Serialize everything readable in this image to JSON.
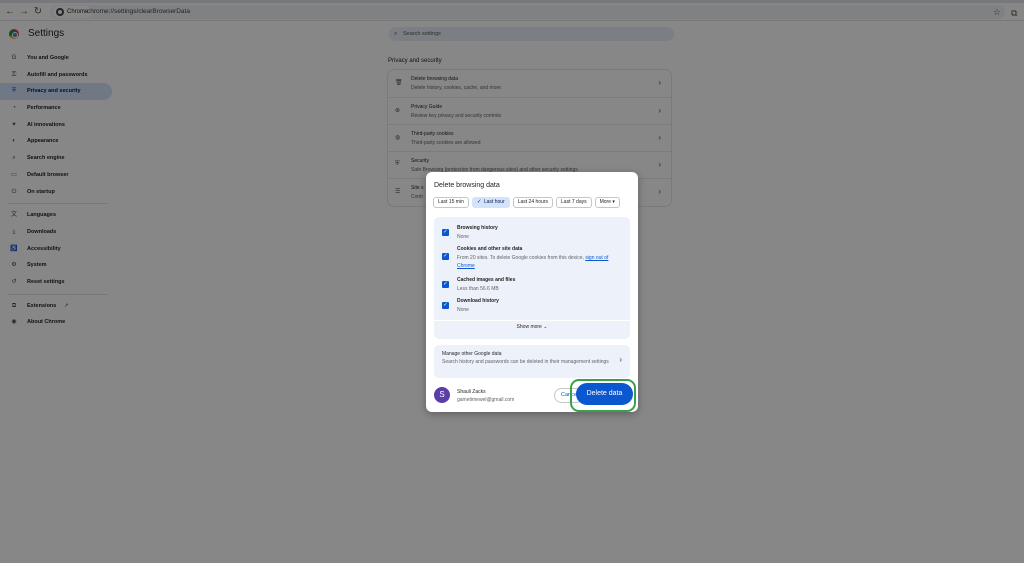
{
  "browser": {
    "chip_label": "Chrome",
    "url": "chrome://settings/clearBrowserData",
    "back_icon": "←",
    "forward_icon": "→",
    "reload_icon": "↻",
    "star_icon": "☆",
    "extensions_icon": "⧉"
  },
  "header": {
    "title": "Settings",
    "search_placeholder": "Search settings"
  },
  "sidebar": {
    "items": [
      {
        "label": "You and Google",
        "icon": "G"
      },
      {
        "label": "Autofill and passwords",
        "icon": "⚿"
      },
      {
        "label": "Privacy and security",
        "icon": "⛨"
      },
      {
        "label": "Performance",
        "icon": "◔"
      },
      {
        "label": "AI innovations",
        "icon": "✦"
      },
      {
        "label": "Appearance",
        "icon": "◐"
      },
      {
        "label": "Search engine",
        "icon": "⌕"
      },
      {
        "label": "Default browser",
        "icon": "▭"
      },
      {
        "label": "On startup",
        "icon": "⏻"
      },
      {
        "label": "Languages",
        "icon": "文"
      },
      {
        "label": "Downloads",
        "icon": "⤓"
      },
      {
        "label": "Accessibility",
        "icon": "♿"
      },
      {
        "label": "System",
        "icon": "⚙"
      },
      {
        "label": "Reset settings",
        "icon": "↺"
      },
      {
        "label": "Extensions",
        "icon": "⧉",
        "ext_icon": "↗"
      },
      {
        "label": "About Chrome",
        "icon": "◉"
      }
    ]
  },
  "main": {
    "section_title": "Privacy and security",
    "rows": [
      {
        "title": "Delete browsing data",
        "subtitle": "Delete history, cookies, cache, and more",
        "icon": "🗑"
      },
      {
        "title": "Privacy Guide",
        "subtitle": "Review key privacy and security controls",
        "icon": "⊕"
      },
      {
        "title": "Third-party cookies",
        "subtitle": "Third-party cookies are allowed",
        "icon": "◍"
      },
      {
        "title": "Security",
        "subtitle": "Safe Browsing (protection from dangerous sites) and other security settings",
        "icon": "⛨"
      },
      {
        "title": "Site s",
        "subtitle": "Contr",
        "icon": "☰"
      }
    ],
    "chevron": "›"
  },
  "dialog": {
    "title": "Delete browsing data",
    "time_chips": [
      {
        "label": "Last 15 min",
        "selected": false
      },
      {
        "label": "Last hour",
        "selected": true
      },
      {
        "label": "Last 24 hours",
        "selected": false
      },
      {
        "label": "Last 7 days",
        "selected": false
      },
      {
        "label": "More",
        "selected": false
      }
    ],
    "check": "✓",
    "more_caret": "▾",
    "options": [
      {
        "title": "Browsing history",
        "detail": "None"
      },
      {
        "title": "Cookies and other site data",
        "detail": "From 20 sites. To delete Google cookies from this device,",
        "link": "sign out of Chrome"
      },
      {
        "title": "Cached images and files",
        "detail": "Less than 56.6 MB"
      },
      {
        "title": "Download history",
        "detail": "None"
      }
    ],
    "show_more": "Show more",
    "show_more_caret": "⌄",
    "manage_title": "Manage other Google data",
    "manage_subtitle": "Search history and passwords can be deleted in their management settings",
    "manage_chevron": "›",
    "user_initial": "S",
    "user_name": "Shauli Zacks",
    "user_email": "gametimewel@gmail.com",
    "cancel_label": "Cancel",
    "delete_label": "Delete data"
  },
  "colors": {
    "accent": "#0b57d0",
    "active_nav": "#d3e3fd",
    "avatar": "#5b3ea8",
    "highlight_ring": "#3aa04a"
  }
}
